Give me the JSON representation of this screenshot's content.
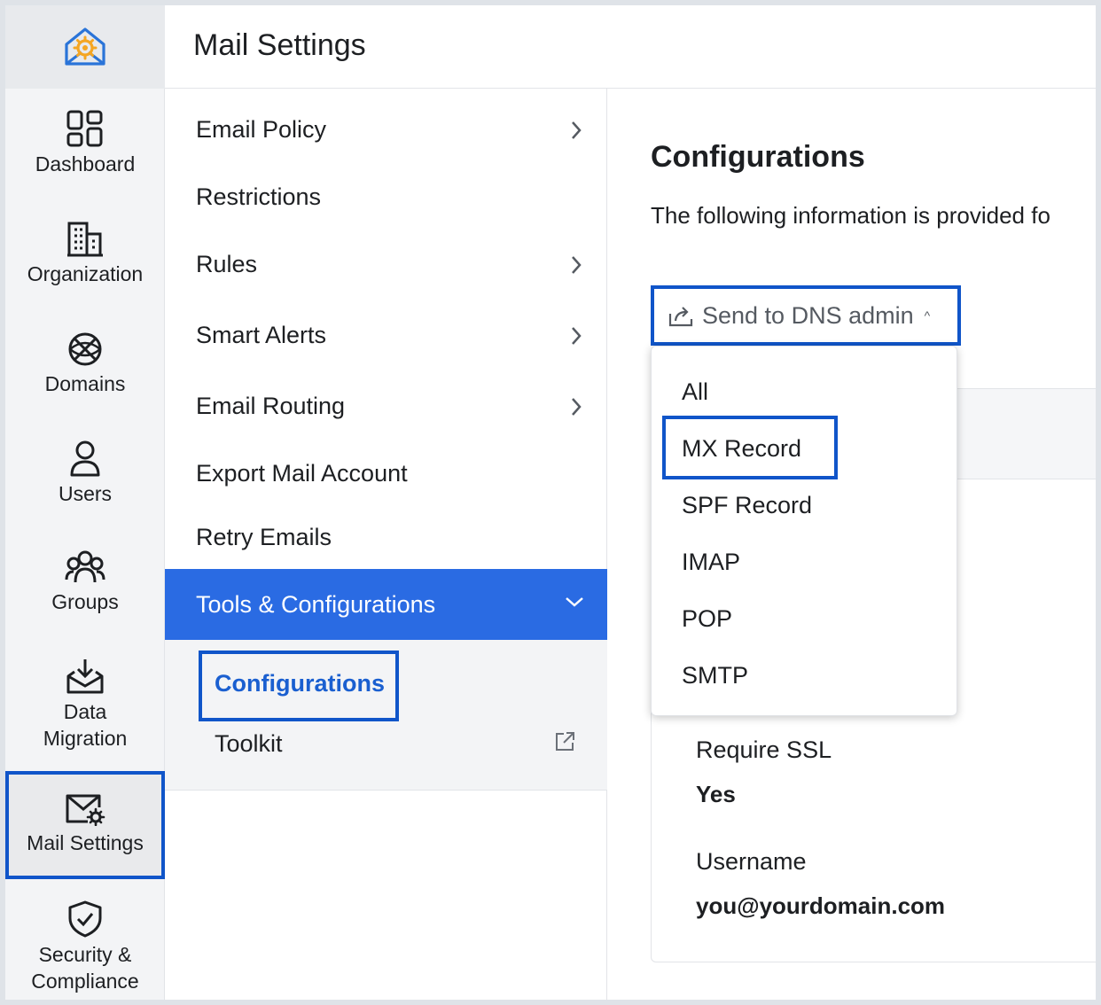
{
  "header": {
    "title": "Mail Settings"
  },
  "rail": {
    "items": [
      {
        "label": "Dashboard",
        "icon": "dashboard-icon"
      },
      {
        "label": "Organization",
        "icon": "organization-icon"
      },
      {
        "label": "Domains",
        "icon": "globe-icon"
      },
      {
        "label": "Users",
        "icon": "user-icon"
      },
      {
        "label": "Groups",
        "icon": "groups-icon"
      },
      {
        "label_line1": "Data",
        "label_line2": "Migration",
        "icon": "inbox-download-icon"
      },
      {
        "label": "Mail Settings",
        "icon": "mail-settings-icon"
      },
      {
        "label_line1": "Security &",
        "label_line2": "Compliance",
        "icon": "shield-check-icon"
      }
    ]
  },
  "menu": {
    "items": [
      {
        "label": "Email Policy",
        "has_chevron": true
      },
      {
        "label": "Restrictions",
        "has_chevron": false
      },
      {
        "label": "Rules",
        "has_chevron": true
      },
      {
        "label": "Smart Alerts",
        "has_chevron": true
      },
      {
        "label": "Email Routing",
        "has_chevron": true
      },
      {
        "label": "Export Mail Account",
        "has_chevron": false
      },
      {
        "label": "Retry Emails",
        "has_chevron": false
      },
      {
        "label": "Tools & Configurations",
        "expanded": true
      }
    ],
    "sub_items": [
      {
        "label": "Configurations",
        "current": true
      },
      {
        "label": "Toolkit",
        "external": true
      }
    ]
  },
  "content": {
    "title": "Configurations",
    "description": "The following information is provided fo",
    "dns_button": "Send to DNS admin",
    "fields": [
      {
        "label": "Require SSL",
        "value": "Yes"
      },
      {
        "label": "Username",
        "value": "you@yourdomain.com"
      }
    ]
  },
  "dropdown": {
    "options": [
      "All",
      "MX Record",
      "SPF Record",
      "IMAP",
      "POP",
      "SMTP"
    ],
    "highlighted": "MX Record"
  },
  "colors": {
    "accent": "#2a6be3",
    "focus": "#1055c9",
    "link": "#1a5fd0",
    "logo_orange": "#f5a623"
  }
}
